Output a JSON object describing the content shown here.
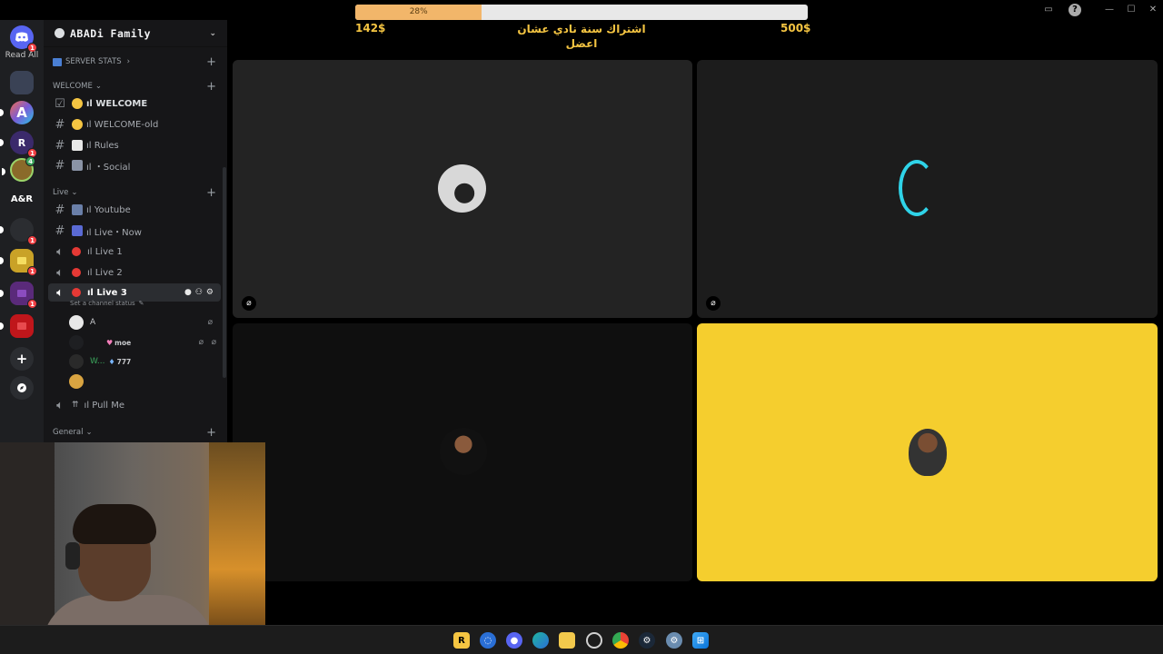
{
  "rail": {
    "read_all": "Read All",
    "servers": [
      {
        "label": "",
        "badge": "1",
        "color": "#5865f2"
      },
      {
        "label": "",
        "badge": "",
        "color": "#3a4255"
      },
      {
        "label": "A",
        "badge": "",
        "color": "#7a5bd6"
      },
      {
        "label": "R",
        "badge": "1",
        "color": "#3b2a6b"
      },
      {
        "label": "",
        "badge": "4",
        "color": "#8a6a2a"
      },
      {
        "label": "A&R",
        "badge": "",
        "color": "#1e1f22"
      },
      {
        "label": "",
        "badge": "1",
        "color": "#2b2d31"
      },
      {
        "label": "",
        "badge": "1",
        "color": "#c9a227"
      },
      {
        "label": "",
        "badge": "1",
        "color": "#5a2a7a"
      },
      {
        "label": "",
        "badge": "",
        "color": "#c0161b"
      }
    ]
  },
  "sidebar": {
    "server_name": "ABADi Family",
    "stats_label": "SERVER STATS",
    "categories": {
      "welcome": "WELCOME",
      "live": "Live",
      "general": "General"
    },
    "channels": {
      "welcome": "ıl WELCOME",
      "welcome_old": "ıl WELCOME-old",
      "rules": "ıl Rules",
      "social": "ıl  ・Social",
      "youtube": "ıl Youtube",
      "live_now": "ıl Live・Now",
      "live1": "ıl Live 1",
      "live2": "ıl Live 2",
      "live3": "ıl Live 3",
      "pull_me": "ıl Pull Me"
    },
    "channel_status": "Set a channel status",
    "voice_users": [
      {
        "name": "A",
        "tag": ""
      },
      {
        "name": "",
        "tag": "moe"
      },
      {
        "name": "W...",
        "tag": "777"
      },
      {
        "name": "",
        "tag": ""
      }
    ]
  },
  "goal": {
    "progress_percent": 28,
    "progress_label": "28%",
    "current": "142$",
    "target": "500$",
    "title": "اشتراك سنة نادي عشان اعضل"
  },
  "tiles": {
    "tile4_color": "#f5ce2e"
  }
}
